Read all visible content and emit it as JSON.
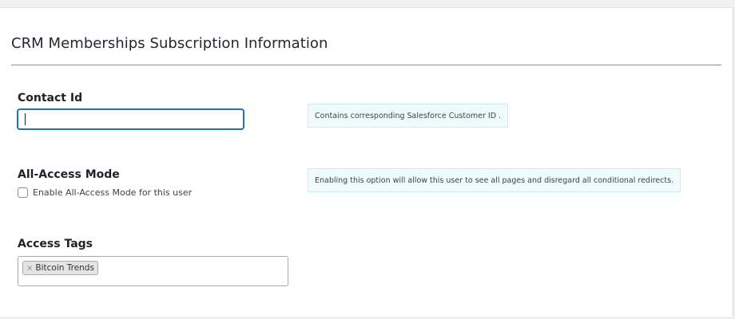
{
  "section": {
    "title": "CRM Memberships Subscription Information"
  },
  "contact_id": {
    "label": "Contact Id",
    "value": "",
    "help": "Contains corresponding Salesforce Customer ID ."
  },
  "all_access": {
    "label": "All-Access Mode",
    "checkbox_label": "Enable All-Access Mode for this user",
    "checked": false,
    "help": "Enabling this option will allow this user to see all pages and disregard all conditional redirects."
  },
  "access_tags": {
    "label": "Access Tags",
    "tags": [
      {
        "remove_symbol": "×",
        "label": "Bitcoin Trends"
      }
    ]
  },
  "icons": {
    "tag_remove": "close-icon"
  },
  "colors": {
    "focus_border": "#2271b1",
    "help_background": "#f0fbfc",
    "help_border": "#c8eef2"
  }
}
